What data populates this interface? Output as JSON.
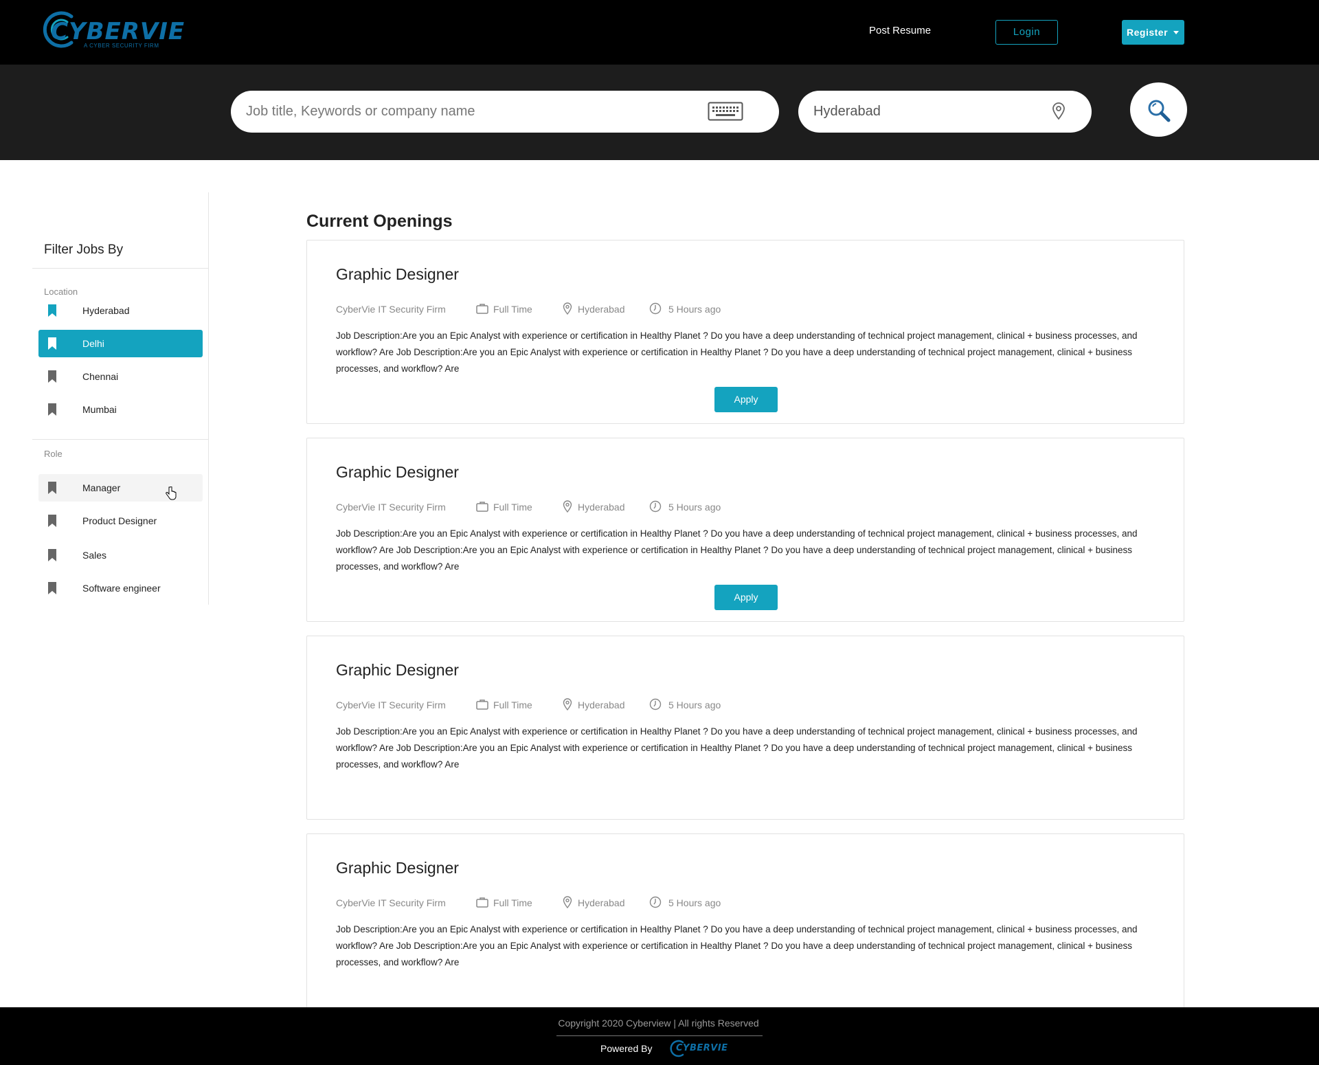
{
  "header": {
    "logo_text": "CYBERVIE",
    "logo_tagline": "A CYBER SECURITY FIRM",
    "post_resume": "Post Resume",
    "login": "Login",
    "register": "Register"
  },
  "search": {
    "keyword_placeholder": "Job title, Keywords or company name",
    "location_value": "Hyderabad"
  },
  "sidebar": {
    "title": "Filter Jobs By",
    "location_label": "Location",
    "locations": [
      "Hyderabad",
      "Delhi",
      "Chennai",
      "Mumbai"
    ],
    "active_location": "Delhi",
    "role_label": "Role",
    "roles": [
      "Manager",
      "Product Designer",
      "Sales",
      "Software engineer"
    ],
    "hovered_role": "Manager"
  },
  "main": {
    "title": "Current Openings",
    "jobs": [
      {
        "title": "Graphic Designer",
        "company": "CyberVie IT Security Firm",
        "type": "Full Time",
        "location": "Hyderabad",
        "posted": "5 Hours ago",
        "description": "Job Description:Are you an Epic Analyst with experience or certification in Healthy Planet ? Do you have a deep understanding of technical project management, clinical + business processes, and workflow? Are Job Description:Are you an Epic Analyst with experience or certification in Healthy Planet ? Do you have a deep understanding of technical project management, clinical + business processes, and workflow? Are",
        "apply": "Apply"
      },
      {
        "title": "Graphic Designer",
        "company": "CyberVie IT Security Firm",
        "type": "Full Time",
        "location": "Hyderabad",
        "posted": "5 Hours ago",
        "description": "Job Description:Are you an Epic Analyst with experience or certification in Healthy Planet ? Do you have a deep understanding of technical project management, clinical + business processes, and workflow? Are Job Description:Are you an Epic Analyst with experience or certification in Healthy Planet ? Do you have a deep understanding of technical project management, clinical + business processes, and workflow? Are",
        "apply": "Apply"
      },
      {
        "title": "Graphic Designer",
        "company": "CyberVie IT Security Firm",
        "type": "Full Time",
        "location": "Hyderabad",
        "posted": "5 Hours ago",
        "description": "Job Description:Are you an Epic Analyst with experience or certification in Healthy Planet ? Do you have a deep understanding of technical project management, clinical + business processes, and workflow? Are Job Description:Are you an Epic Analyst with experience or certification in Healthy Planet ? Do you have a deep understanding of technical project management, clinical + business processes, and workflow? Are"
      },
      {
        "title": "Graphic Designer",
        "company": "CyberVie IT Security Firm",
        "type": "Full Time",
        "location": "Hyderabad",
        "posted": "5 Hours ago",
        "description": "Job Description:Are you an Epic Analyst with experience or certification in Healthy Planet ? Do you have a deep understanding of technical project management, clinical + business processes, and workflow? Are Job Description:Are you an Epic Analyst with experience or certification in Healthy Planet ? Do you have a deep understanding of technical project management, clinical + business processes, and workflow? Are"
      }
    ]
  },
  "footer": {
    "copyright": "Copyright 2020 Cyberview | All rights Reserved",
    "powered_by": "Powered By",
    "logo_text": "CYBERVIE"
  },
  "colors": {
    "accent": "#14a3bf",
    "brand": "#0e6fa6",
    "header_bg": "#000000",
    "search_band_bg": "#1d1d1d"
  },
  "icons": {
    "keyboard": "keyboard-icon",
    "location": "map-pin-icon",
    "search": "search-icon",
    "bookmark": "bookmark-icon",
    "briefcase": "briefcase-icon",
    "clock": "clock-icon"
  }
}
